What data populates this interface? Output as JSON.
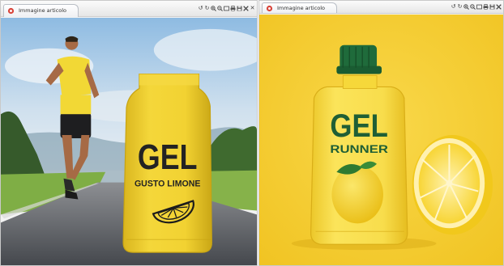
{
  "windows": [
    {
      "id": "left",
      "tab_title": "Immagine articolo",
      "photo": {
        "product_name": "GEL",
        "flavor": "GUSTO LIMONE"
      }
    },
    {
      "id": "right",
      "tab_title": "Immagine articolo",
      "photo": {
        "product_name": "GEL",
        "product_subname": "RUNNER"
      }
    }
  ],
  "toolbar": {
    "icons": [
      "rotate-left-icon",
      "rotate-right-icon",
      "zoom-in-icon",
      "zoom-out-icon",
      "fit-icon",
      "print-icon",
      "save-icon",
      "expand-icon",
      "close-icon"
    ]
  },
  "colors": {
    "pouch_yellow": "#f1d22e",
    "cap_green": "#1f6b3b",
    "background_yellow": "#f6cc2c",
    "text_dark": "#2a2a2a"
  }
}
